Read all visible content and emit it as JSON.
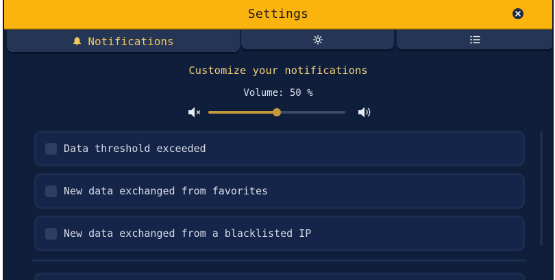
{
  "window": {
    "title": "Settings"
  },
  "tabs": [
    {
      "label": "Notifications",
      "icon": "bell-icon",
      "active": true
    },
    {
      "label": "",
      "icon": "sun-icon",
      "active": false
    },
    {
      "label": "",
      "icon": "list-icon",
      "active": false
    }
  ],
  "notifications": {
    "heading": "Customize your notifications",
    "volume_label": "Volume: 50 %",
    "volume_value": 0.5,
    "items": [
      {
        "label": "Data threshold exceeded",
        "checked": false
      },
      {
        "label": "New data exchanged from favorites",
        "checked": false
      },
      {
        "label": "New data exchanged from a blacklisted IP",
        "checked": false
      }
    ]
  },
  "colors": {
    "titlebar": "#fbb30d",
    "background": "#0f1e3a",
    "accent": "#f5c65a",
    "slider": "#c4993a"
  }
}
